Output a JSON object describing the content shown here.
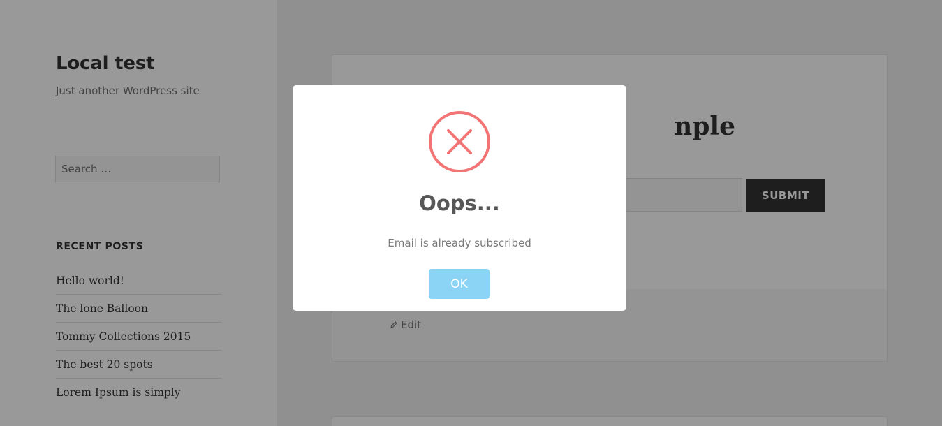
{
  "site": {
    "title": "Local test",
    "description": "Just another WordPress site"
  },
  "search": {
    "placeholder": "Search …"
  },
  "recent_posts": {
    "heading": "RECENT POSTS",
    "items": [
      "Hello world!",
      "The lone Balloon",
      "Tommy Collections 2015",
      "The best 20 spots",
      "Lorem Ipsum is simply"
    ]
  },
  "post": {
    "title_visible": "nple",
    "submit_label": "SUBMIT",
    "edit_label": "Edit"
  },
  "modal": {
    "icon": "error-x-icon",
    "title": "Oops...",
    "text": "Email is already subscribed",
    "ok_label": "OK"
  },
  "colors": {
    "error": "#f27474",
    "ok_button": "#8cd4f5",
    "submit_button": "#333333"
  }
}
